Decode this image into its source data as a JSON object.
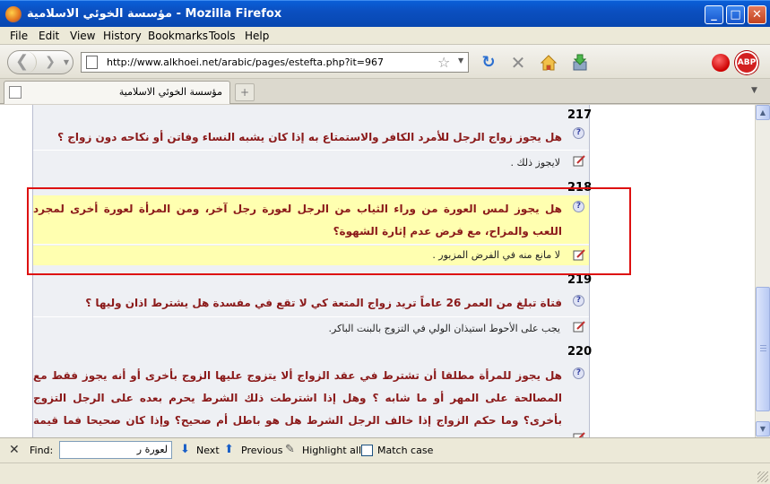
{
  "window": {
    "title": "مؤسسة الخوئي الاسلامية - Mozilla Firefox",
    "controls": {
      "minimize": "_",
      "maximize": "□",
      "close": "✕"
    }
  },
  "menu": [
    "File",
    "Edit",
    "View",
    "History",
    "Bookmarks",
    "Tools",
    "Help"
  ],
  "navbar": {
    "url": "http://www.alkhoei.net/arabic/pages/estefta.php?it=967",
    "abp_label": "ABP"
  },
  "tab": {
    "title": "مؤسسة الخوئي الاسلامية",
    "new_tab": "+"
  },
  "entries": [
    {
      "number": "217",
      "question": "هل يجوز زواج الرجل للأمرد الكافر والاستمتاع به إذا كان يشبه النساء وفاتن أو نكاحه دون زواج ؟",
      "answer": "لايجوز ذلك ."
    },
    {
      "number": "218",
      "question": "هل يجوز لمس العورة من وراء الثياب من الرجل لعورة رجل آخر، ومن المرأة لعورة أخرى لمجرد اللعب والمزاح، مع فرض عدم إثارة الشهوة؟",
      "answer": "لا مانع منه في الفرض المزبور ."
    },
    {
      "number": "219",
      "question": "فتاة تبلغ من العمر 26 عاماً تريد زواج المتعة كي لا تقع في مفسدة هل يشترط اذان وليها ؟",
      "answer": "يجب على الأحوط استيذان الولي في التزوج بالبنت الباكر."
    },
    {
      "number": "220",
      "question": "هل يجوز للمرأة مطلقا أن تشترط في عقد الزواج ألا يتزوج عليها الزوج بأخرى أو أنه يجوز فقط مع المصالحة على المهر أو ما شابه ؟ وهل إذا اشترطت ذلك الشرط يحرم بعده على الرجل التزوج بأخرى؟ وما حكم الزواج إذا خالف الرجل الشرط هل هو باطل أم صحيح؟ وإذا كان صحيحا فما قيمة الشرط حينئذ؟",
      "answer": ""
    }
  ],
  "findbar": {
    "close": "✕",
    "label": "Find:",
    "query": "لعورة ر",
    "next": "Next",
    "previous": "Previous",
    "highlight_all": "Highlight all",
    "match_case": "Match case",
    "match_case_checked": false
  },
  "colors": {
    "question_text": "#8b1a1a",
    "highlight": "#ffffb0",
    "annotation_box": "#dd1111"
  }
}
